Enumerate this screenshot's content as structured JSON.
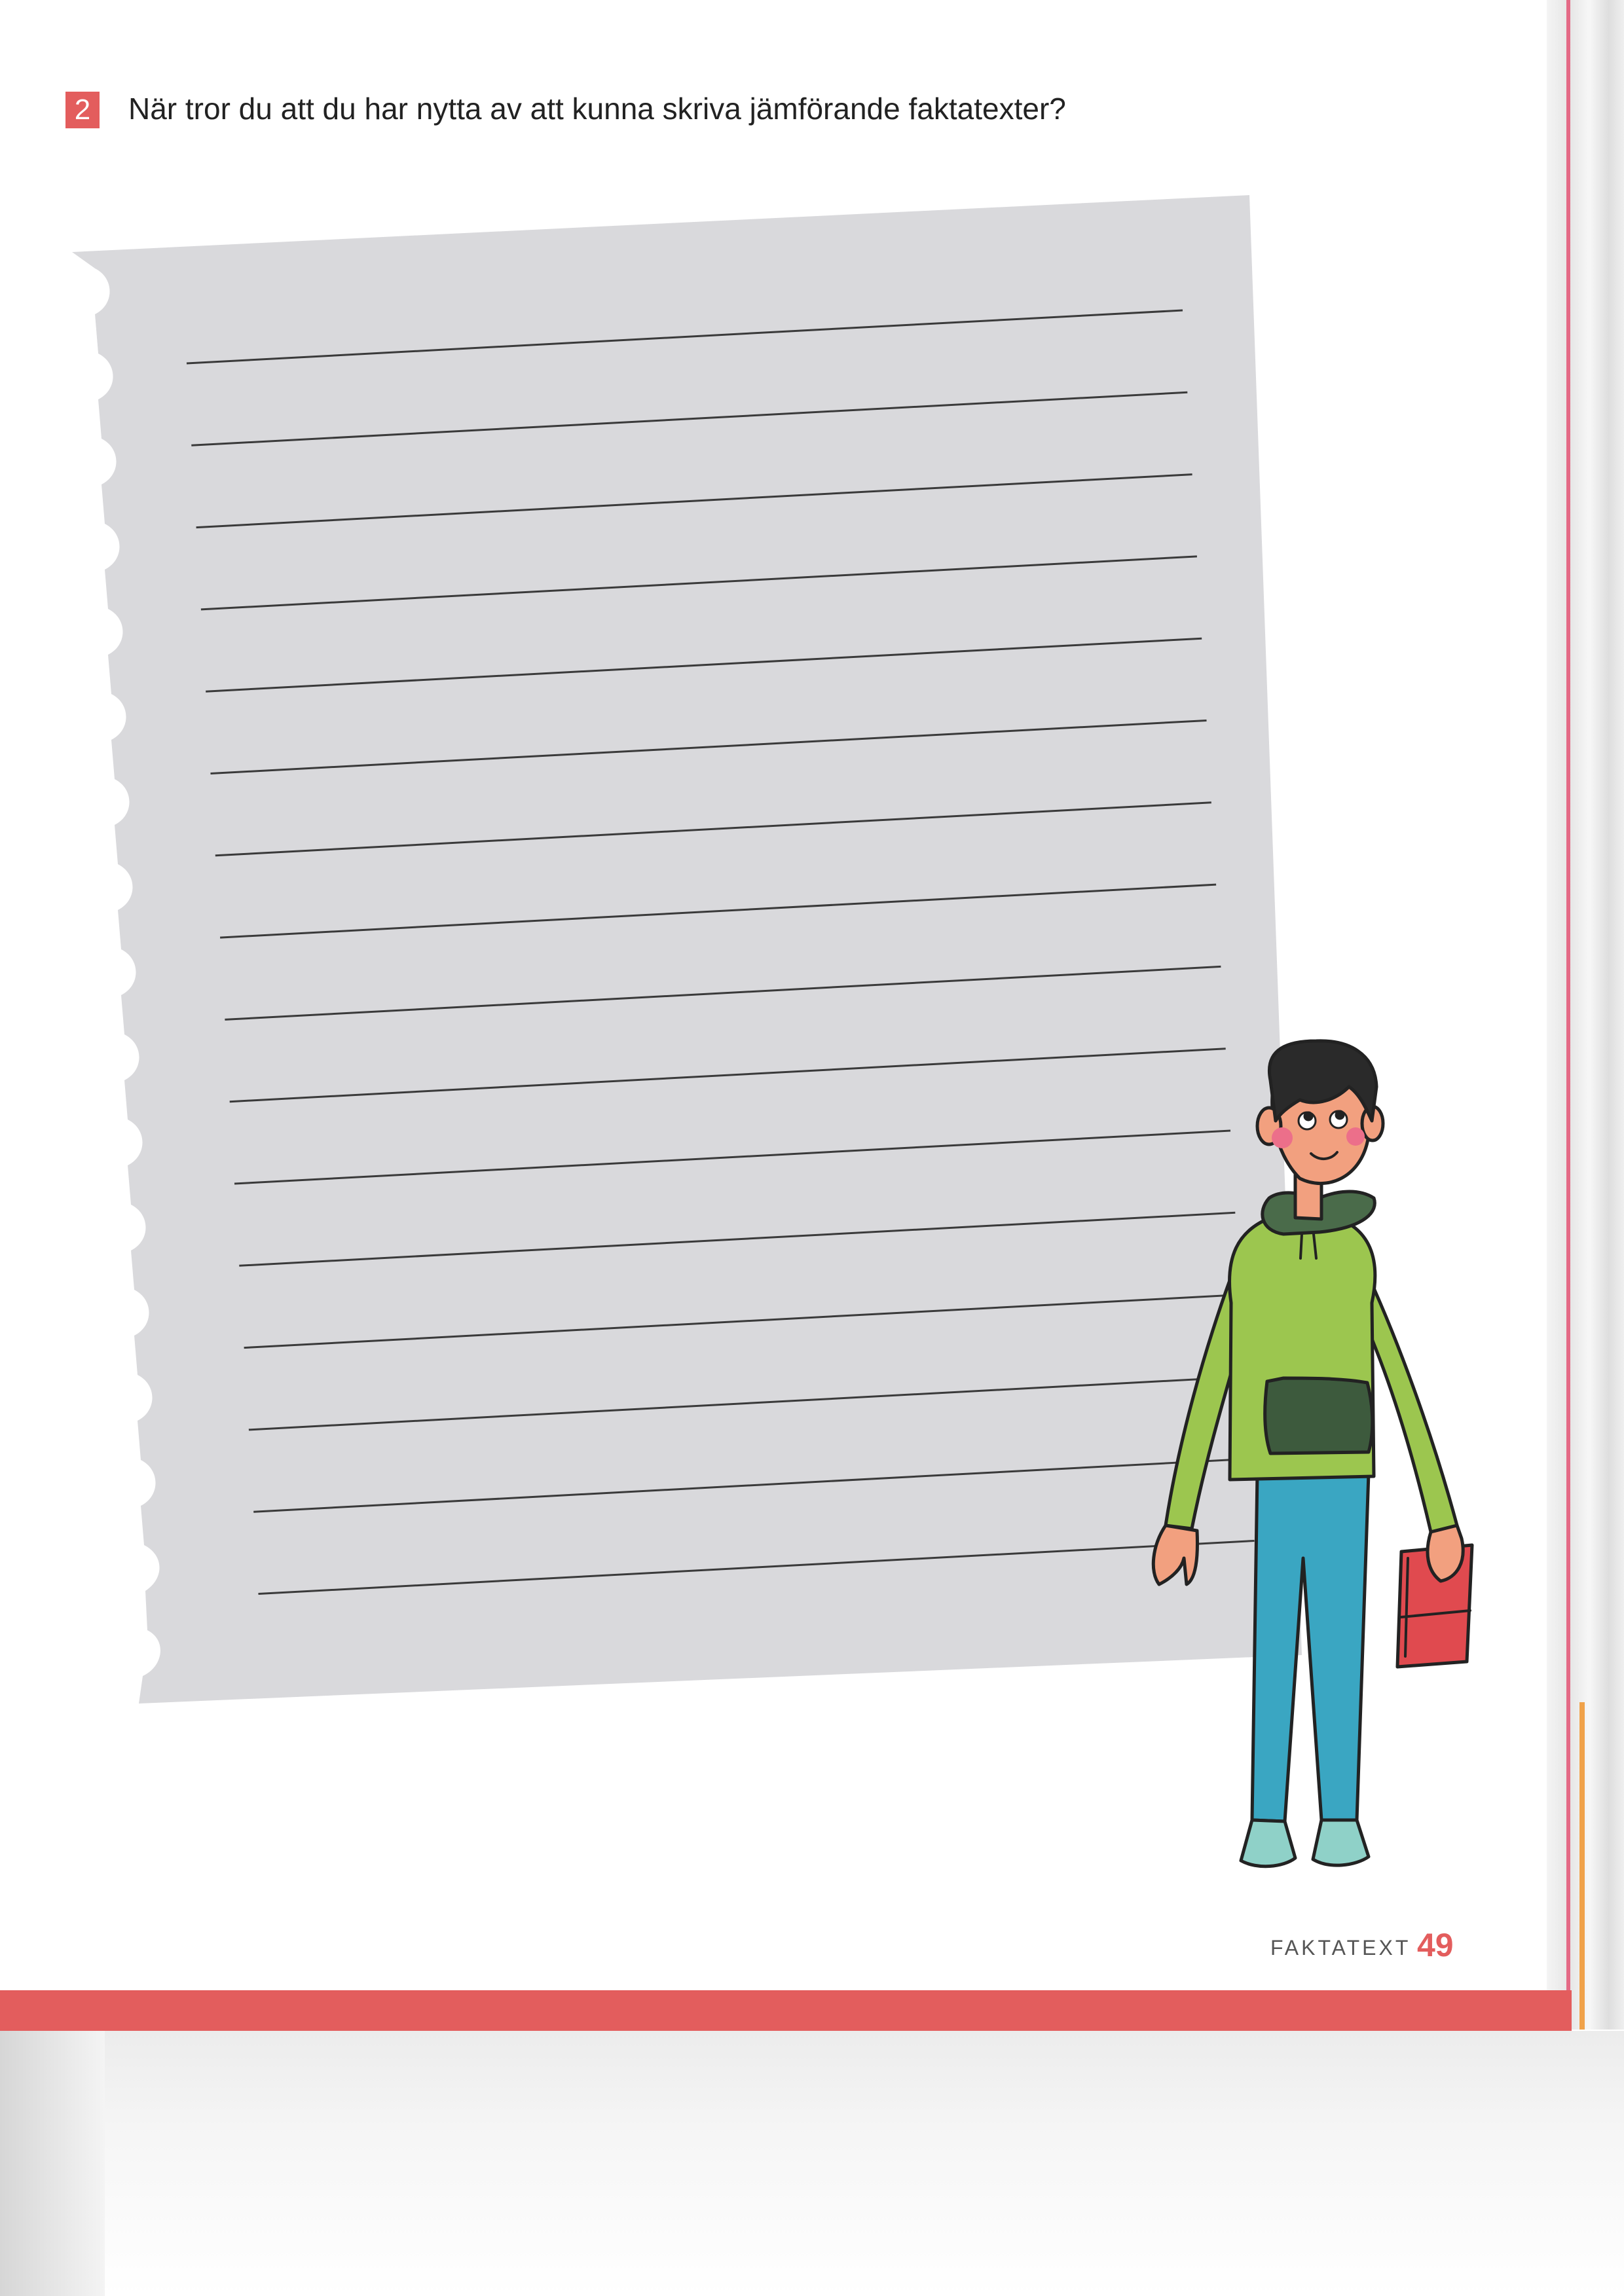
{
  "question": {
    "number": "2",
    "text": "När tror du att du har nytta av att kunna skriva jämförande faktatexter?"
  },
  "writing_paper": {
    "line_count": 16
  },
  "illustration": {
    "figure": "boy in green hoodie and blue trousers holding a red book"
  },
  "footer": {
    "section": "FAKTATEXT",
    "page_number": "49"
  },
  "colors": {
    "accent": "#e35d5d",
    "paper": "#d9d9dc",
    "hoodie": "#9cc64f",
    "trousers": "#3aa6c2",
    "book": "#e04a4f"
  }
}
